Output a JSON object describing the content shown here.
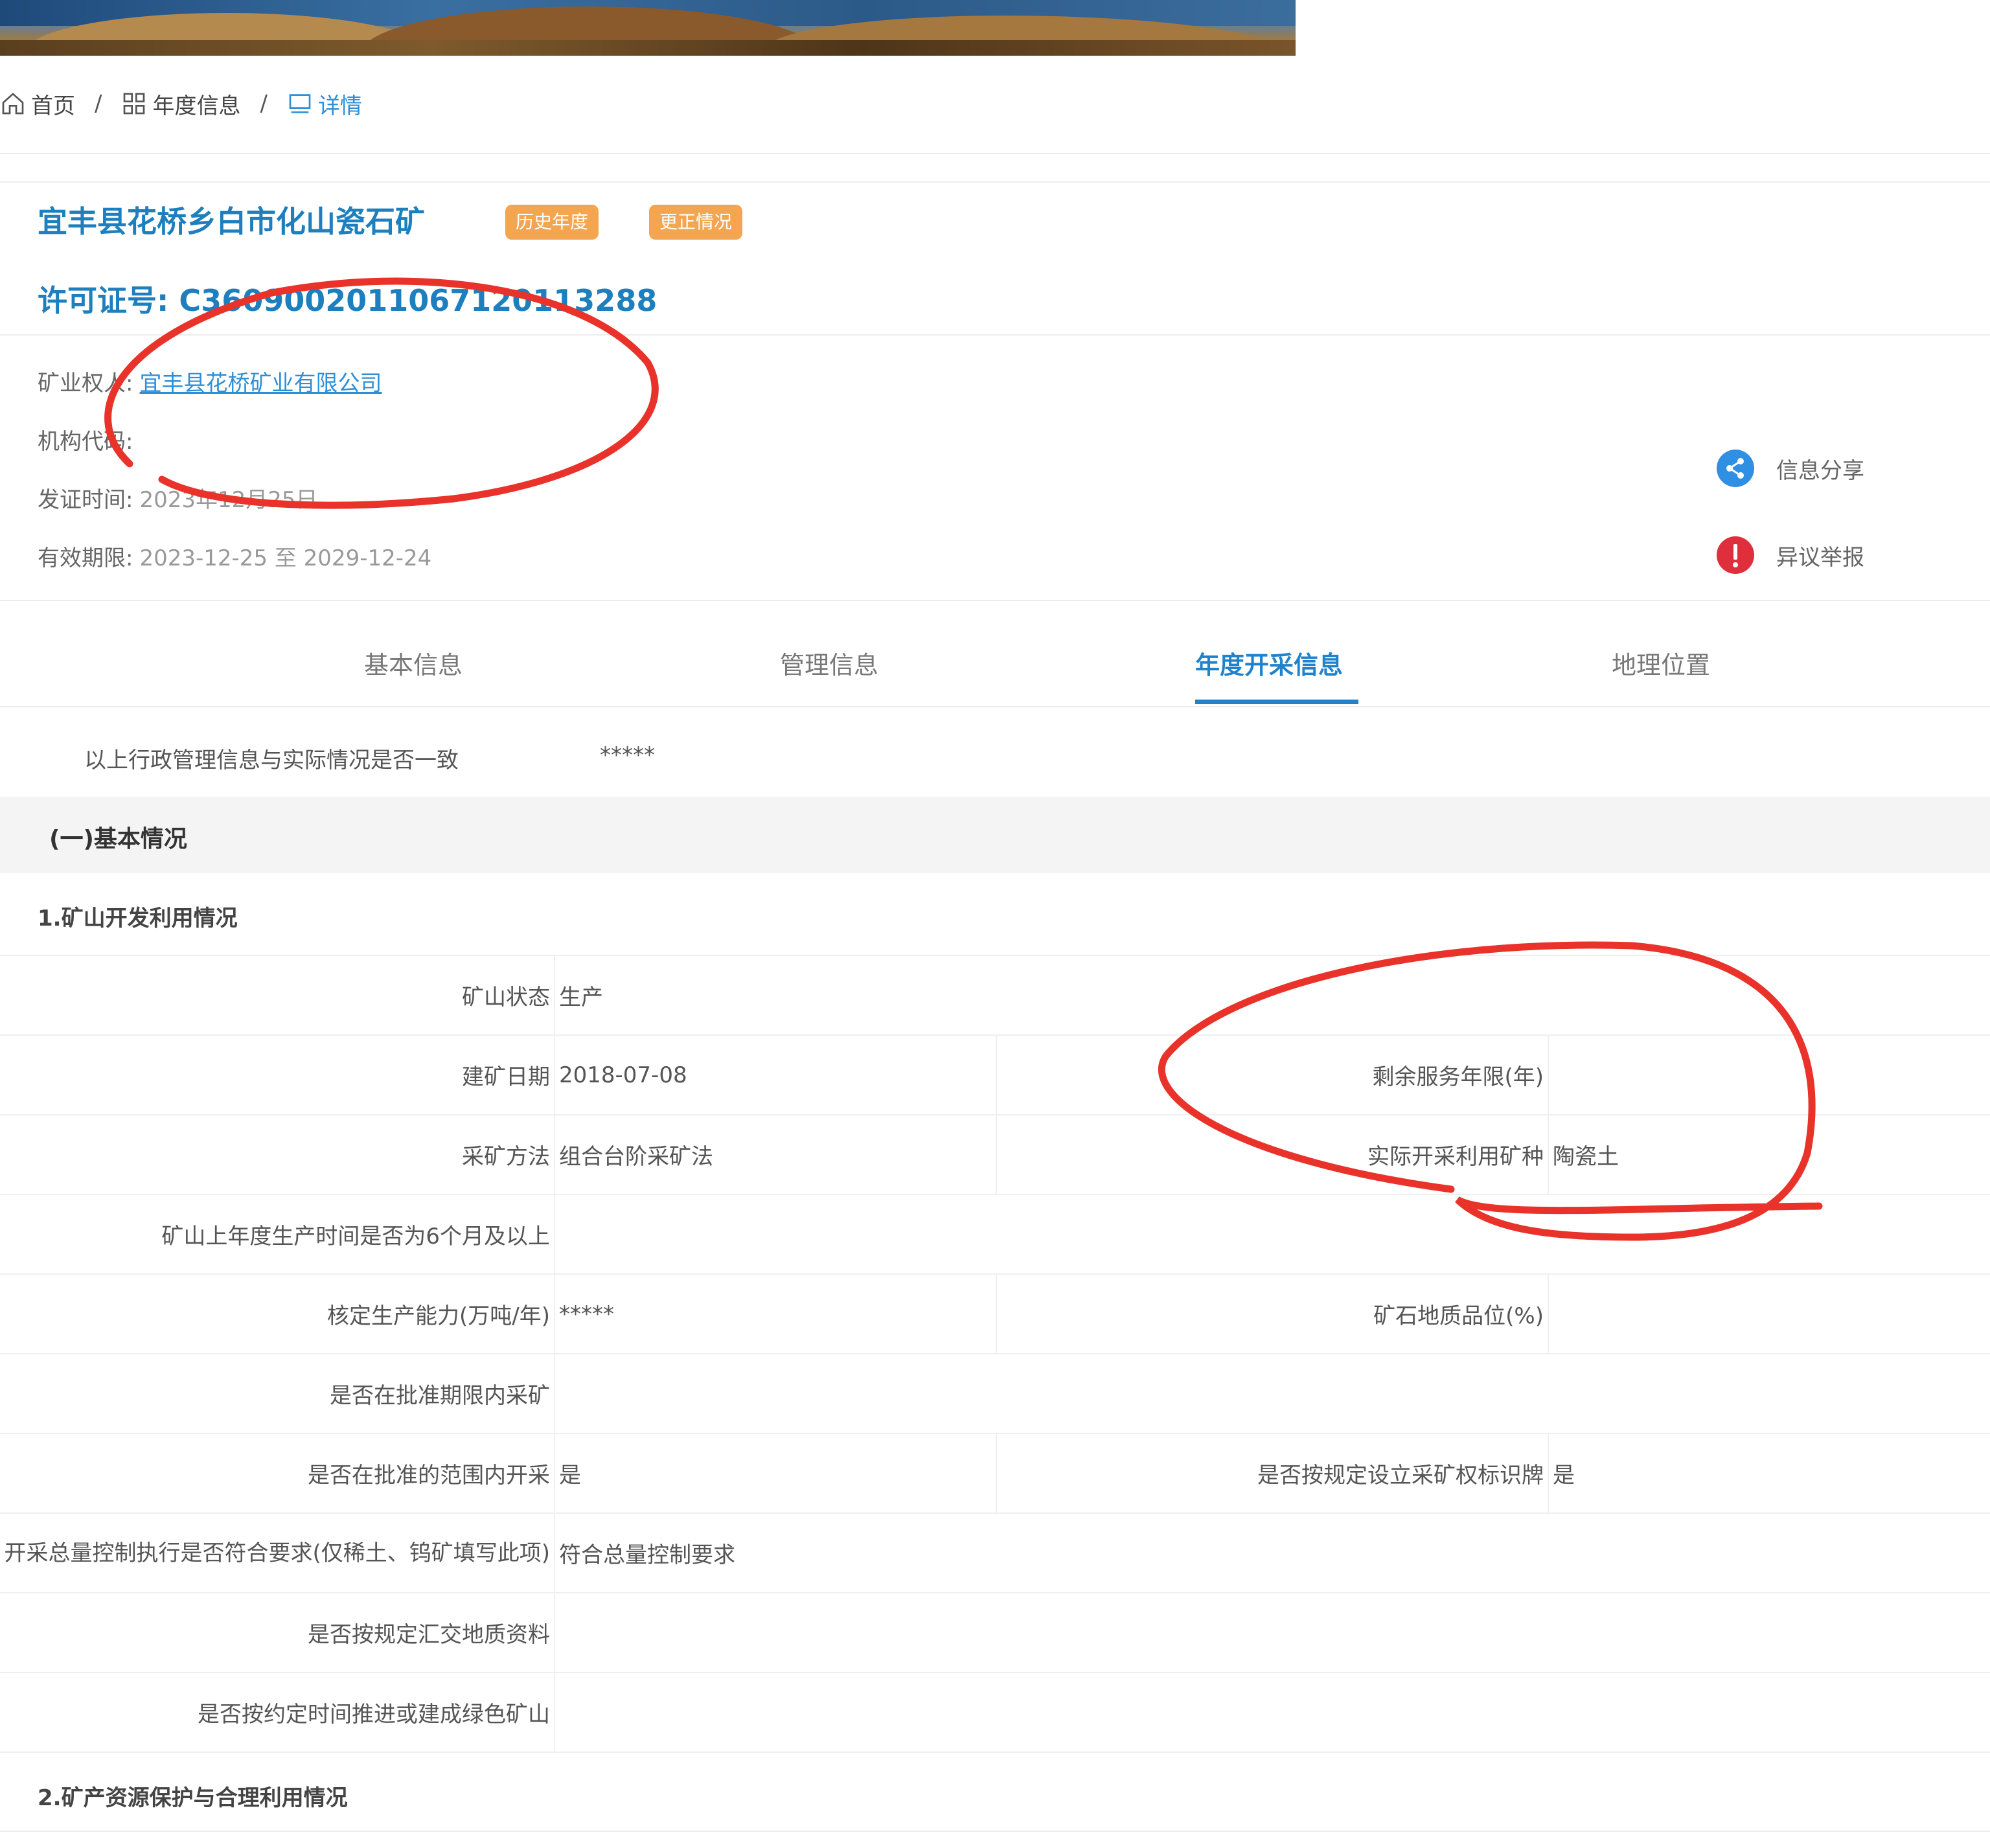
{
  "breadcrumb": {
    "home": "首页",
    "annual": "年度信息",
    "detail": "详情"
  },
  "header": {
    "title": "宜丰县花桥乡白市化山瓷石矿",
    "tags": [
      "历史年度",
      "更正情况"
    ],
    "license_label": "许可证号:",
    "license_number": "C3609002011067120113288"
  },
  "info": {
    "owner_label": "矿业权人:",
    "owner_value": "宜丰县花桥矿业有限公司",
    "org_code_label": "机构代码:",
    "org_code_value": "",
    "issue_date_label": "发证时间:",
    "issue_date_value": "2023年12月25日",
    "validity_label": "有效期限:",
    "validity_value": "2023-12-25 至 2029-12-24"
  },
  "actions": {
    "share": "信息分享",
    "report": "异议举报"
  },
  "colors": {
    "accent": "#1f82cc",
    "tag": "#f3a64f",
    "share": "#2f8fe2",
    "report": "#e02f3c",
    "annotation": "#e8322a"
  },
  "tabs": [
    "基本信息",
    "管理信息",
    "年度开采信息",
    "地理位置"
  ],
  "active_tab": "年度开采信息",
  "consistency": {
    "label": "以上行政管理信息与实际情况是否一致",
    "value": "*****"
  },
  "section1": "(一)基本情况",
  "sub1": "1.矿山开发利用情况",
  "rows": {
    "status_label": "矿山状态",
    "status_value": "生产",
    "build_date_label": "建矿日期",
    "build_date_value": "2018-07-08",
    "remaining_label": "剩余服务年限(年)",
    "remaining_value": "",
    "method_label": "采矿方法",
    "method_value": "组合台阶采矿法",
    "mineral_label": "实际开采利用矿种",
    "mineral_value": "陶瓷土",
    "six_months_label": "矿山上年度生产时间是否为6个月及以上",
    "six_months_value": "",
    "capacity_label": "核定生产能力(万吨/年)",
    "capacity_value": "*****",
    "grade_label": "矿石地质品位(%)",
    "grade_value": "",
    "period_label": "是否在批准期限内采矿",
    "period_value": "",
    "scope_label": "是否在批准的范围内开采",
    "scope_value": "是",
    "sign_label": "是否按规定设立采矿权标识牌",
    "sign_value": "是",
    "quota_label": "开采总量控制执行是否符合要求(仅稀土、钨矿填写此项)",
    "quota_value": "符合总量控制要求",
    "geo_data_label": "是否按规定汇交地质资料",
    "geo_data_value": "",
    "green_label": "是否按约定时间推进或建成绿色矿山",
    "green_value": ""
  },
  "sub2": "2.矿产资源保护与合理利用情况"
}
